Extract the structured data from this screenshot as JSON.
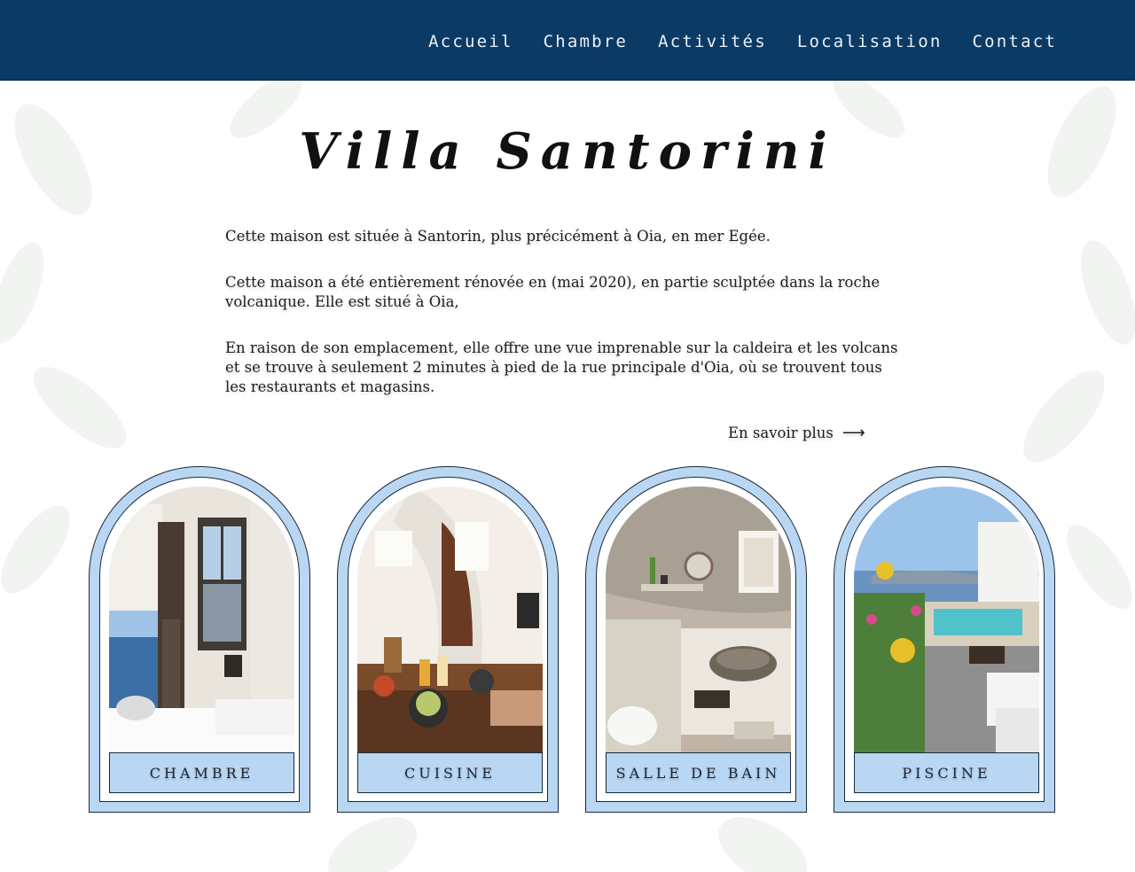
{
  "nav": {
    "items": [
      {
        "label": "Accueil"
      },
      {
        "label": "Chambre"
      },
      {
        "label": "Activités"
      },
      {
        "label": "Localisation"
      },
      {
        "label": "Contact"
      }
    ]
  },
  "main": {
    "title": "Villa Santorini",
    "paragraphs": [
      "Cette maison est située à Santorin, plus précicément à Oia, en mer Egée.",
      "Cette maison a été entièrement rénovée en (mai 2020), en partie sculptée dans la roche volcanique. Elle est situé à Oia,",
      "En raison de son emplacement, elle offre une vue imprenable sur la caldeira et les volcans et se trouve à seulement 2 minutes à pied de la rue principale d'Oia, où se trouvent tous les restaurants et magasins."
    ],
    "more_link": "En savoir plus",
    "more_arrow": "⟶"
  },
  "cards": [
    {
      "label": "CHAMBRE"
    },
    {
      "label": "CUISINE"
    },
    {
      "label": "SALLE DE BAIN"
    },
    {
      "label": "PISCINE"
    }
  ],
  "colors": {
    "header": "#0b3a64",
    "card_accent": "#b9d6f2",
    "outline": "#1a2a3a"
  }
}
